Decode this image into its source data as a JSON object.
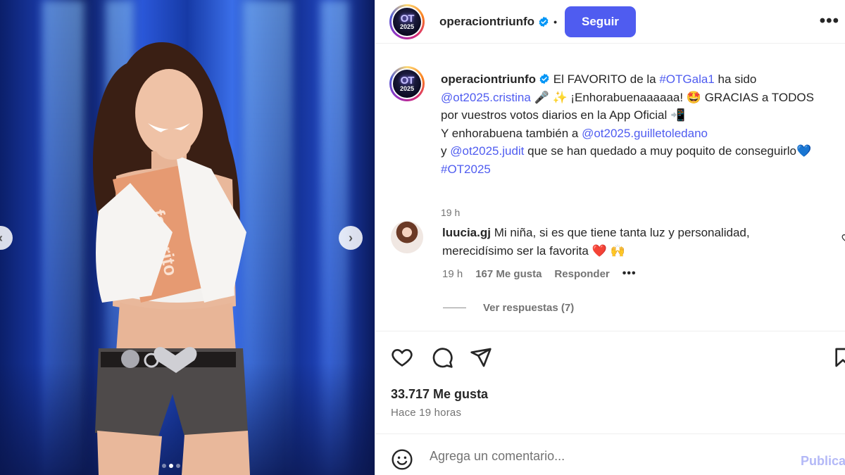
{
  "post": {
    "username": "operaciontriunfo",
    "separator": "•",
    "follow_label": "Seguir",
    "logo_text": "OT",
    "logo_year": "2025",
    "more_icon": "•••"
  },
  "caption": {
    "username": "operaciontriunfo",
    "segments": [
      {
        "t": " El FAVORITO de la ",
        "link": false
      },
      {
        "t": "#OTGala1",
        "link": true
      },
      {
        "t": " ha sido ",
        "link": false
      },
      {
        "t": "@ot2025.cristina",
        "link": true
      },
      {
        "t": " 🎤 ✨ ¡Enhorabuenaaaaaa! 🤩 GRACIAS a TODOS por vuestros votos diarios en la App Oficial 📲",
        "link": false
      },
      {
        "t": "\nY enhorabuena también a ",
        "link": false
      },
      {
        "t": "@ot2025.guilletoledano",
        "link": true
      },
      {
        "t": "\ny ",
        "link": false
      },
      {
        "t": "@ot2025.judit",
        "link": true
      },
      {
        "t": " que se han quedado a muy poquito de conseguirlo💙 ",
        "link": false
      },
      {
        "t": "#OT2025",
        "link": true
      }
    ],
    "time": "19 h"
  },
  "comment": {
    "username": "luucia.gj",
    "text": " Mi niña, si es que tiene tanta luz y personalidad, merecidísimo ser la favorita ❤️ 🙌",
    "time": "19 h",
    "likes": "167 Me gusta",
    "reply_label": "Responder",
    "more": "•••",
    "view_replies": "Ver respuestas (7)"
  },
  "engagement": {
    "likes": "33.717 Me gusta",
    "when": "Hace 19 horas"
  },
  "composer": {
    "placeholder": "Agrega un comentario...",
    "publish_label": "Publicar"
  },
  "carousel": {
    "total": 3,
    "active_index": 1
  },
  "colors": {
    "accent": "#4f5cf0",
    "text": "#262626",
    "muted": "#737373",
    "publish_disabled": "#b3b8f7"
  }
}
